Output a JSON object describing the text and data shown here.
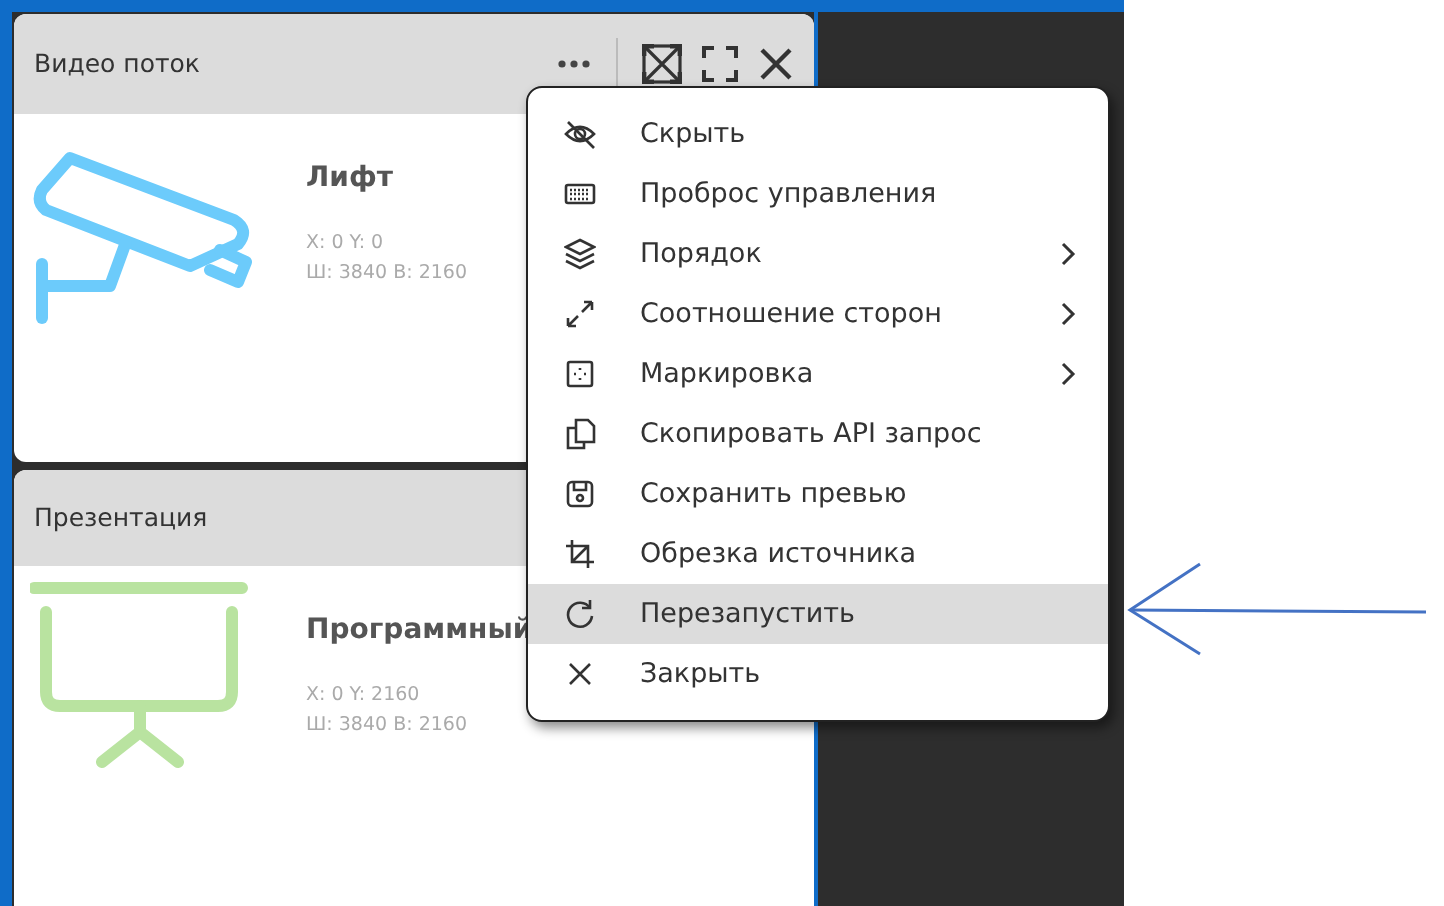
{
  "panels": [
    {
      "title": "Видео поток",
      "kind": "camera",
      "source": "Лифт",
      "position": "X: 0 Y: 0",
      "size": "Ш: 3840 В: 2160",
      "header_buttons": true
    },
    {
      "title": "Презентация",
      "kind": "projector",
      "source": "Программный",
      "position": "X: 0 Y: 2160",
      "size": "Ш: 3840 В: 2160"
    }
  ],
  "context_menu": {
    "items": [
      {
        "label": "Скрыть",
        "submenu": false,
        "selected": false
      },
      {
        "label": "Проброс управления",
        "submenu": false,
        "selected": false
      },
      {
        "label": "Порядок",
        "submenu": true,
        "selected": false
      },
      {
        "label": "Соотношение сторон",
        "submenu": true,
        "selected": false
      },
      {
        "label": "Маркировка",
        "submenu": true,
        "selected": false
      },
      {
        "label": "Скопировать API запрос",
        "submenu": false,
        "selected": false
      },
      {
        "label": "Сохранить превью",
        "submenu": false,
        "selected": false
      },
      {
        "label": "Обрезка источника",
        "submenu": false,
        "selected": false
      },
      {
        "label": "Перезапустить",
        "submenu": false,
        "selected": true
      },
      {
        "label": "Закрыть",
        "submenu": false,
        "selected": false
      }
    ]
  }
}
